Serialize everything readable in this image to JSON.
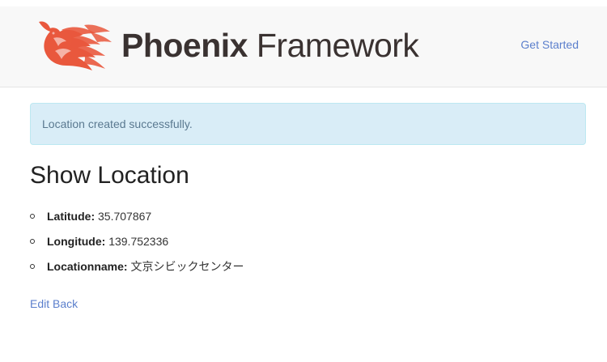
{
  "header": {
    "brand_bold": "Phoenix",
    "brand_light": "Framework",
    "nav_link": "Get Started",
    "logo_icon": "phoenix-bird-icon",
    "logo_color": "#e9583d"
  },
  "alert": {
    "message": "Location created successfully.",
    "background": "#d9edf7"
  },
  "main": {
    "title": "Show Location",
    "fields": [
      {
        "label": "Latitude:",
        "value": "35.707867"
      },
      {
        "label": "Longitude:",
        "value": "139.752336"
      },
      {
        "label": "Locationname:",
        "value": "文京シビックセンター"
      }
    ],
    "actions": {
      "edit": "Edit",
      "back": "Back"
    }
  },
  "colors": {
    "link": "#5b7fcc",
    "brand_text": "#3a3231"
  }
}
